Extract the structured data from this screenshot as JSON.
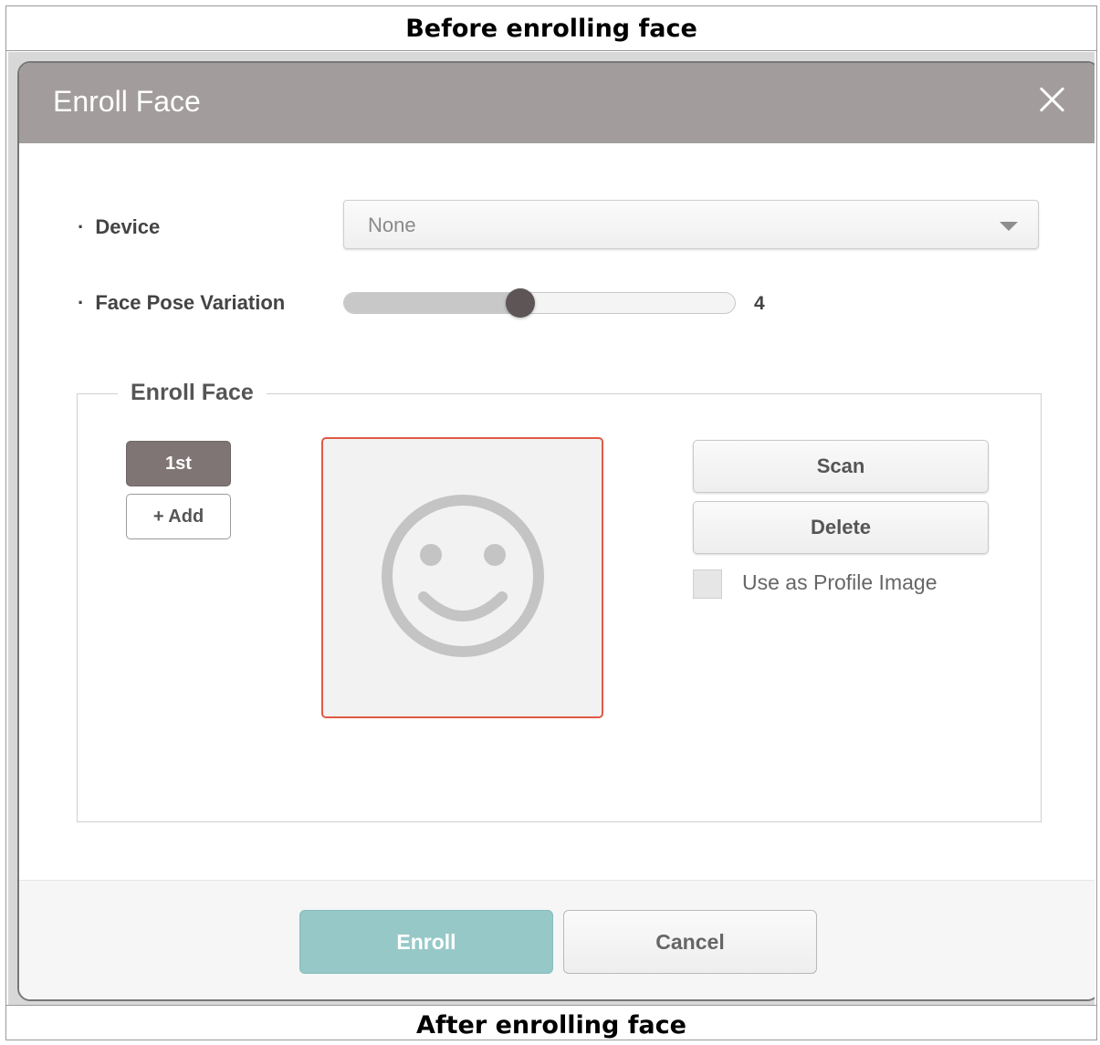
{
  "captions": {
    "before": "Before enrolling face",
    "after": "After enrolling face"
  },
  "dialog": {
    "title": "Enroll Face",
    "close_icon": "close-icon",
    "device": {
      "label": "Device",
      "value": "None"
    },
    "pose": {
      "label": "Face Pose Variation",
      "value": "4",
      "level_fraction": 0.45
    },
    "enroll_section": {
      "legend": "Enroll Face",
      "slots": [
        "1st"
      ],
      "add_label": "+ Add",
      "placeholder_icon": "smiley-face-icon",
      "scan_label": "Scan",
      "delete_label": "Delete",
      "profile_checkbox_label": "Use as Profile Image"
    },
    "footer": {
      "enroll_label": "Enroll",
      "cancel_label": "Cancel"
    }
  },
  "colors": {
    "header": "#a29c9c",
    "enroll_button": "#97c8c8",
    "face_border": "#e05a45",
    "selected_slot": "#7f7575"
  }
}
